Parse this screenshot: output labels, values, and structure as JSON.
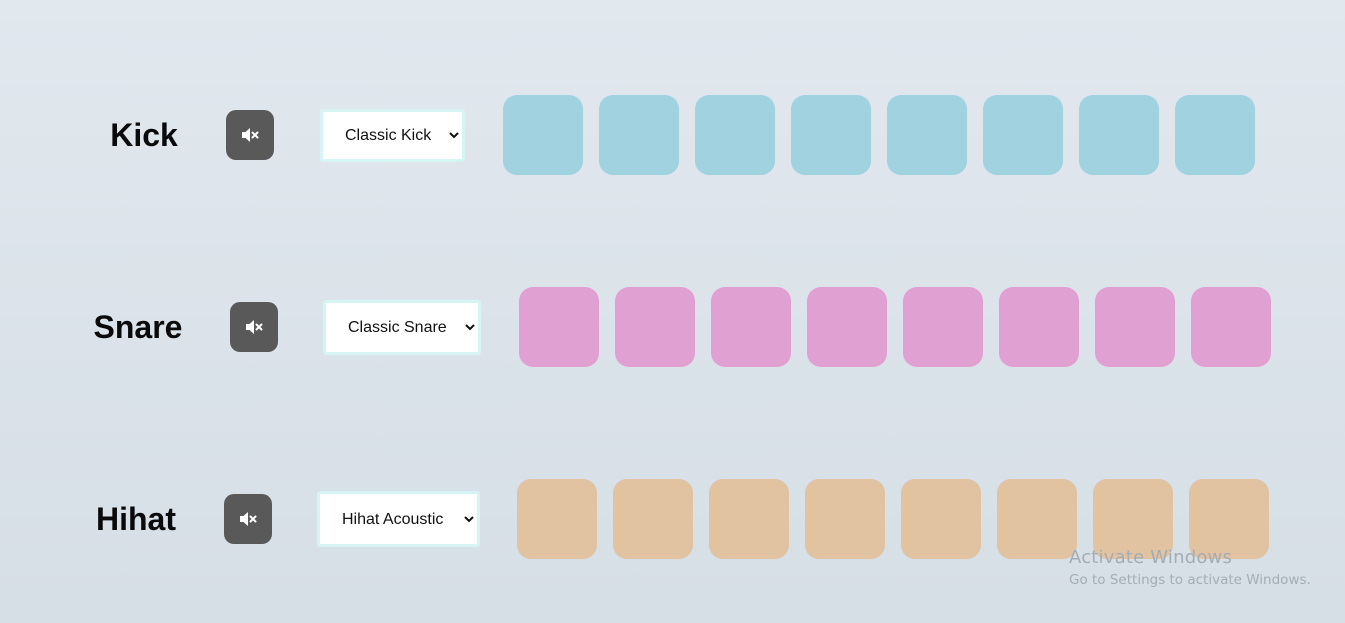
{
  "tracks": [
    {
      "name": "Kick",
      "muted_icon": "speaker-muted-icon",
      "selected_sound": "Classic Kick",
      "pad_color": "#a0d2df",
      "pad_count": 8
    },
    {
      "name": "Snare",
      "muted_icon": "speaker-muted-icon",
      "selected_sound": "Classic Snare",
      "pad_color": "#e0a0d2",
      "pad_count": 8
    },
    {
      "name": "Hihat",
      "muted_icon": "speaker-muted-icon",
      "selected_sound": "Hihat Acoustic",
      "pad_color": "#e1c2a1",
      "pad_count": 8
    }
  ],
  "watermark": {
    "title": "Activate Windows",
    "subtitle": "Go to Settings to activate Windows."
  },
  "colors": {
    "mute_button": "#595959",
    "select_border": "#d6f4f4"
  }
}
